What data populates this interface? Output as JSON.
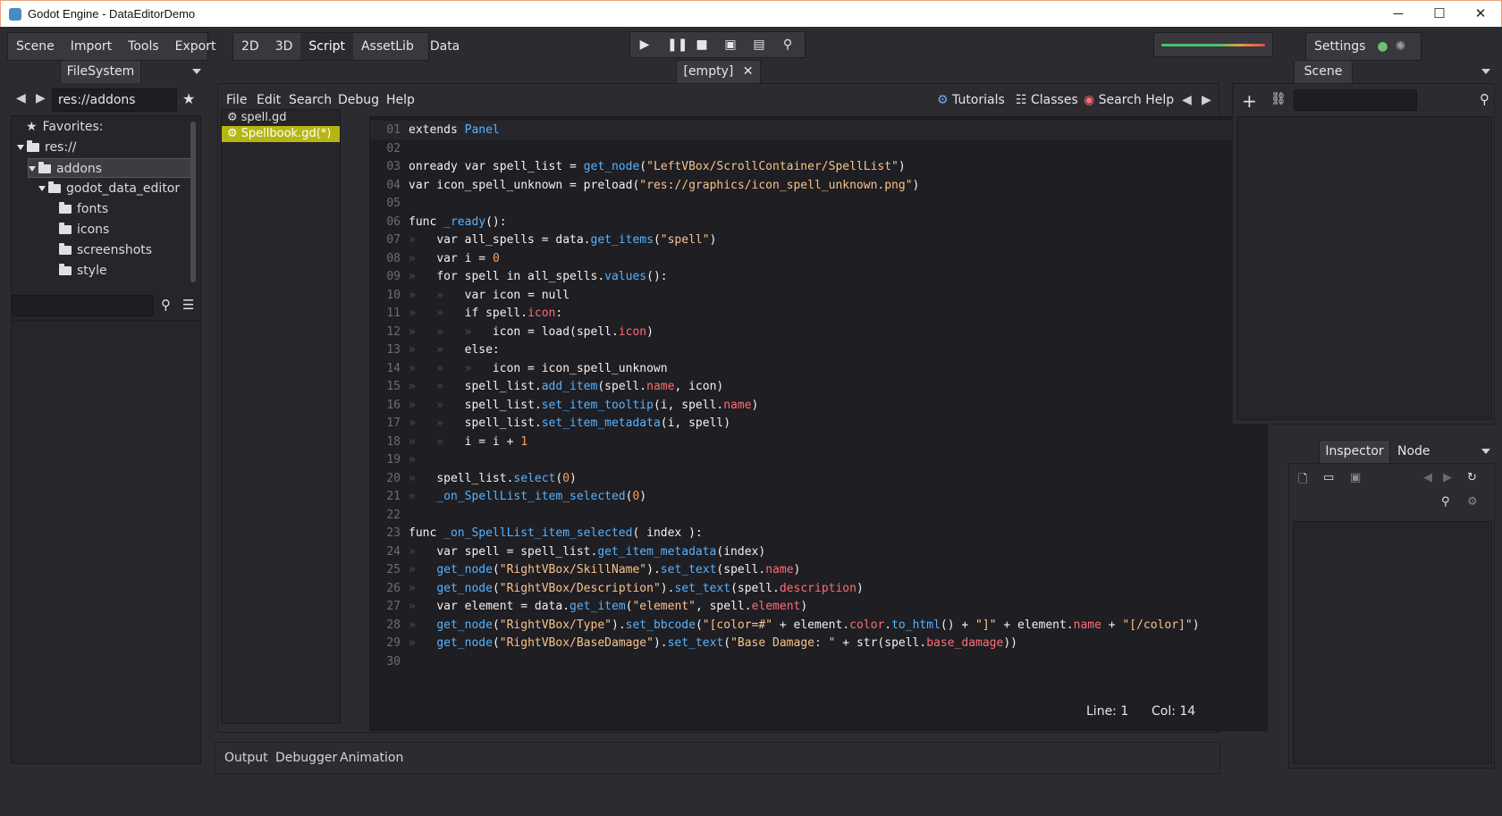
{
  "window": {
    "title": "Godot Engine - DataEditorDemo",
    "minimize": "─",
    "maximize": "☐",
    "close": "✕"
  },
  "main_menu": {
    "scene": "Scene",
    "import": "Import",
    "tools": "Tools",
    "export": "Export"
  },
  "workspaces": {
    "d2": "2D",
    "d3": "3D",
    "script": "Script",
    "assetlib": "AssetLib",
    "data": "Data"
  },
  "settings_label": "Settings",
  "filesystem": {
    "tab": "FileSystem",
    "path": "res://addons",
    "favorites": "Favorites:",
    "tree": {
      "root": "res://",
      "addons": "addons",
      "editor": "godot_data_editor",
      "fonts": "fonts",
      "icons": "icons",
      "screenshots": "screenshots",
      "style": "style"
    }
  },
  "editor_tab": "[empty]",
  "script_menu": {
    "file": "File",
    "edit": "Edit",
    "search": "Search",
    "debug": "Debug",
    "help": "Help",
    "tutorials": "Tutorials",
    "classes": "Classes",
    "search_help": "Search Help"
  },
  "scripts": [
    "spell.gd",
    "Spellbook.gd(*)"
  ],
  "code": [
    {
      "n": "01",
      "t": [
        [
          "kw",
          "extends "
        ],
        [
          "fn",
          "Panel"
        ]
      ]
    },
    {
      "n": "02",
      "t": []
    },
    {
      "n": "03",
      "t": [
        [
          "kw",
          "onready var spell_list = "
        ],
        [
          "fn",
          "get_node"
        ],
        [
          "kw",
          "("
        ],
        [
          "st",
          "\"LeftVBox/ScrollContainer/SpellList\""
        ],
        [
          "kw",
          ")"
        ]
      ]
    },
    {
      "n": "04",
      "t": [
        [
          "kw",
          "var icon_spell_unknown = "
        ],
        [
          "kw",
          "preload("
        ],
        [
          "st",
          "\"res://graphics/icon_spell_unknown.png\""
        ],
        [
          "kw",
          ")"
        ]
      ]
    },
    {
      "n": "05",
      "t": []
    },
    {
      "n": "06",
      "t": [
        [
          "kw",
          "func "
        ],
        [
          "fn",
          "_ready"
        ],
        [
          "kw",
          "():"
        ]
      ]
    },
    {
      "n": "07",
      "t": [
        [
          "tb",
          "»   "
        ],
        [
          "kw",
          "var all_spells = data."
        ],
        [
          "fn",
          "get_items"
        ],
        [
          "kw",
          "("
        ],
        [
          "st",
          "\"spell\""
        ],
        [
          "kw",
          ")"
        ]
      ]
    },
    {
      "n": "08",
      "t": [
        [
          "tb",
          "»   "
        ],
        [
          "kw",
          "var i = "
        ],
        [
          "nm",
          "0"
        ]
      ]
    },
    {
      "n": "09",
      "t": [
        [
          "tb",
          "»   "
        ],
        [
          "kw",
          "for spell in all_spells."
        ],
        [
          "fn",
          "values"
        ],
        [
          "kw",
          "():"
        ]
      ]
    },
    {
      "n": "10",
      "t": [
        [
          "tb",
          "»   »   "
        ],
        [
          "kw",
          "var icon = null"
        ]
      ]
    },
    {
      "n": "11",
      "t": [
        [
          "tb",
          "»   »   "
        ],
        [
          "kw",
          "if spell."
        ],
        [
          "pr",
          "icon"
        ],
        [
          "kw",
          ":"
        ]
      ]
    },
    {
      "n": "12",
      "t": [
        [
          "tb",
          "»   »   »   "
        ],
        [
          "kw",
          "icon = load(spell."
        ],
        [
          "pr",
          "icon"
        ],
        [
          "kw",
          ")"
        ]
      ]
    },
    {
      "n": "13",
      "t": [
        [
          "tb",
          "»   »   "
        ],
        [
          "kw",
          "else:"
        ]
      ]
    },
    {
      "n": "14",
      "t": [
        [
          "tb",
          "»   »   »   "
        ],
        [
          "kw",
          "icon = icon_spell_unknown"
        ]
      ]
    },
    {
      "n": "15",
      "t": [
        [
          "tb",
          "»   »   "
        ],
        [
          "kw",
          "spell_list."
        ],
        [
          "fn",
          "add_item"
        ],
        [
          "kw",
          "(spell."
        ],
        [
          "pr",
          "name"
        ],
        [
          "kw",
          ", icon)"
        ]
      ]
    },
    {
      "n": "16",
      "t": [
        [
          "tb",
          "»   »   "
        ],
        [
          "kw",
          "spell_list."
        ],
        [
          "fn",
          "set_item_tooltip"
        ],
        [
          "kw",
          "(i, spell."
        ],
        [
          "pr",
          "name"
        ],
        [
          "kw",
          ")"
        ]
      ]
    },
    {
      "n": "17",
      "t": [
        [
          "tb",
          "»   »   "
        ],
        [
          "kw",
          "spell_list."
        ],
        [
          "fn",
          "set_item_metadata"
        ],
        [
          "kw",
          "(i, spell)"
        ]
      ]
    },
    {
      "n": "18",
      "t": [
        [
          "tb",
          "»   »   "
        ],
        [
          "kw",
          "i = i + "
        ],
        [
          "nm",
          "1"
        ]
      ]
    },
    {
      "n": "19",
      "t": [
        [
          "tb",
          "»"
        ]
      ]
    },
    {
      "n": "20",
      "t": [
        [
          "tb",
          "»   "
        ],
        [
          "kw",
          "spell_list."
        ],
        [
          "fn",
          "select"
        ],
        [
          "kw",
          "("
        ],
        [
          "nm",
          "0"
        ],
        [
          "kw",
          ")"
        ]
      ]
    },
    {
      "n": "21",
      "t": [
        [
          "tb",
          "»   "
        ],
        [
          "fn",
          "_on_SpellList_item_selected"
        ],
        [
          "kw",
          "("
        ],
        [
          "nm",
          "0"
        ],
        [
          "kw",
          ")"
        ]
      ]
    },
    {
      "n": "22",
      "t": []
    },
    {
      "n": "23",
      "t": [
        [
          "kw",
          "func "
        ],
        [
          "fn",
          "_on_SpellList_item_selected"
        ],
        [
          "kw",
          "( index ):"
        ]
      ]
    },
    {
      "n": "24",
      "t": [
        [
          "tb",
          "»   "
        ],
        [
          "kw",
          "var spell = spell_list."
        ],
        [
          "fn",
          "get_item_metadata"
        ],
        [
          "kw",
          "(index)"
        ]
      ]
    },
    {
      "n": "25",
      "t": [
        [
          "tb",
          "»   "
        ],
        [
          "fn",
          "get_node"
        ],
        [
          "kw",
          "("
        ],
        [
          "st",
          "\"RightVBox/SkillName\""
        ],
        [
          "kw",
          ")."
        ],
        [
          "fn",
          "set_text"
        ],
        [
          "kw",
          "(spell."
        ],
        [
          "pr",
          "name"
        ],
        [
          "kw",
          ")"
        ]
      ]
    },
    {
      "n": "26",
      "t": [
        [
          "tb",
          "»   "
        ],
        [
          "fn",
          "get_node"
        ],
        [
          "kw",
          "("
        ],
        [
          "st",
          "\"RightVBox/Description\""
        ],
        [
          "kw",
          ")."
        ],
        [
          "fn",
          "set_text"
        ],
        [
          "kw",
          "(spell."
        ],
        [
          "pr",
          "description"
        ],
        [
          "kw",
          ")"
        ]
      ]
    },
    {
      "n": "27",
      "t": [
        [
          "tb",
          "»   "
        ],
        [
          "kw",
          "var element = data."
        ],
        [
          "fn",
          "get_item"
        ],
        [
          "kw",
          "("
        ],
        [
          "st",
          "\"element\""
        ],
        [
          "kw",
          ", spell."
        ],
        [
          "pr",
          "element"
        ],
        [
          "kw",
          ")"
        ]
      ]
    },
    {
      "n": "28",
      "t": [
        [
          "tb",
          "»   "
        ],
        [
          "fn",
          "get_node"
        ],
        [
          "kw",
          "("
        ],
        [
          "st",
          "\"RightVBox/Type\""
        ],
        [
          "kw",
          ")."
        ],
        [
          "fn",
          "set_bbcode"
        ],
        [
          "kw",
          "("
        ],
        [
          "st",
          "\"[color=#\""
        ],
        [
          "kw",
          " + element."
        ],
        [
          "pr",
          "color"
        ],
        [
          "kw",
          "."
        ],
        [
          "fn",
          "to_html"
        ],
        [
          "kw",
          "() + "
        ],
        [
          "st",
          "\"]\""
        ],
        [
          "kw",
          " + element."
        ],
        [
          "pr",
          "name"
        ],
        [
          "kw",
          " + "
        ],
        [
          "st",
          "\"[/color]\""
        ],
        [
          "kw",
          ")"
        ]
      ]
    },
    {
      "n": "29",
      "t": [
        [
          "tb",
          "»   "
        ],
        [
          "fn",
          "get_node"
        ],
        [
          "kw",
          "("
        ],
        [
          "st",
          "\"RightVBox/BaseDamage\""
        ],
        [
          "kw",
          ")."
        ],
        [
          "fn",
          "set_text"
        ],
        [
          "kw",
          "("
        ],
        [
          "st",
          "\"Base Damage: \""
        ],
        [
          "kw",
          " + str(spell."
        ],
        [
          "pr",
          "base_damage"
        ],
        [
          "kw",
          "))"
        ]
      ]
    },
    {
      "n": "30",
      "t": []
    }
  ],
  "status": {
    "line": "Line: 1",
    "col": "Col: 14"
  },
  "bottom_tabs": {
    "output": "Output",
    "debugger": "Debugger",
    "animation": "Animation"
  },
  "scene_tab": "Scene",
  "inspector": {
    "tab": "Inspector",
    "node_tab": "Node"
  },
  "colors": {
    "accent": "#478cbf",
    "selected_script": "#c8c817",
    "string": "#f8c38a",
    "function": "#57b3ff",
    "number": "#ff9f5a",
    "property": "#ff6c76"
  }
}
